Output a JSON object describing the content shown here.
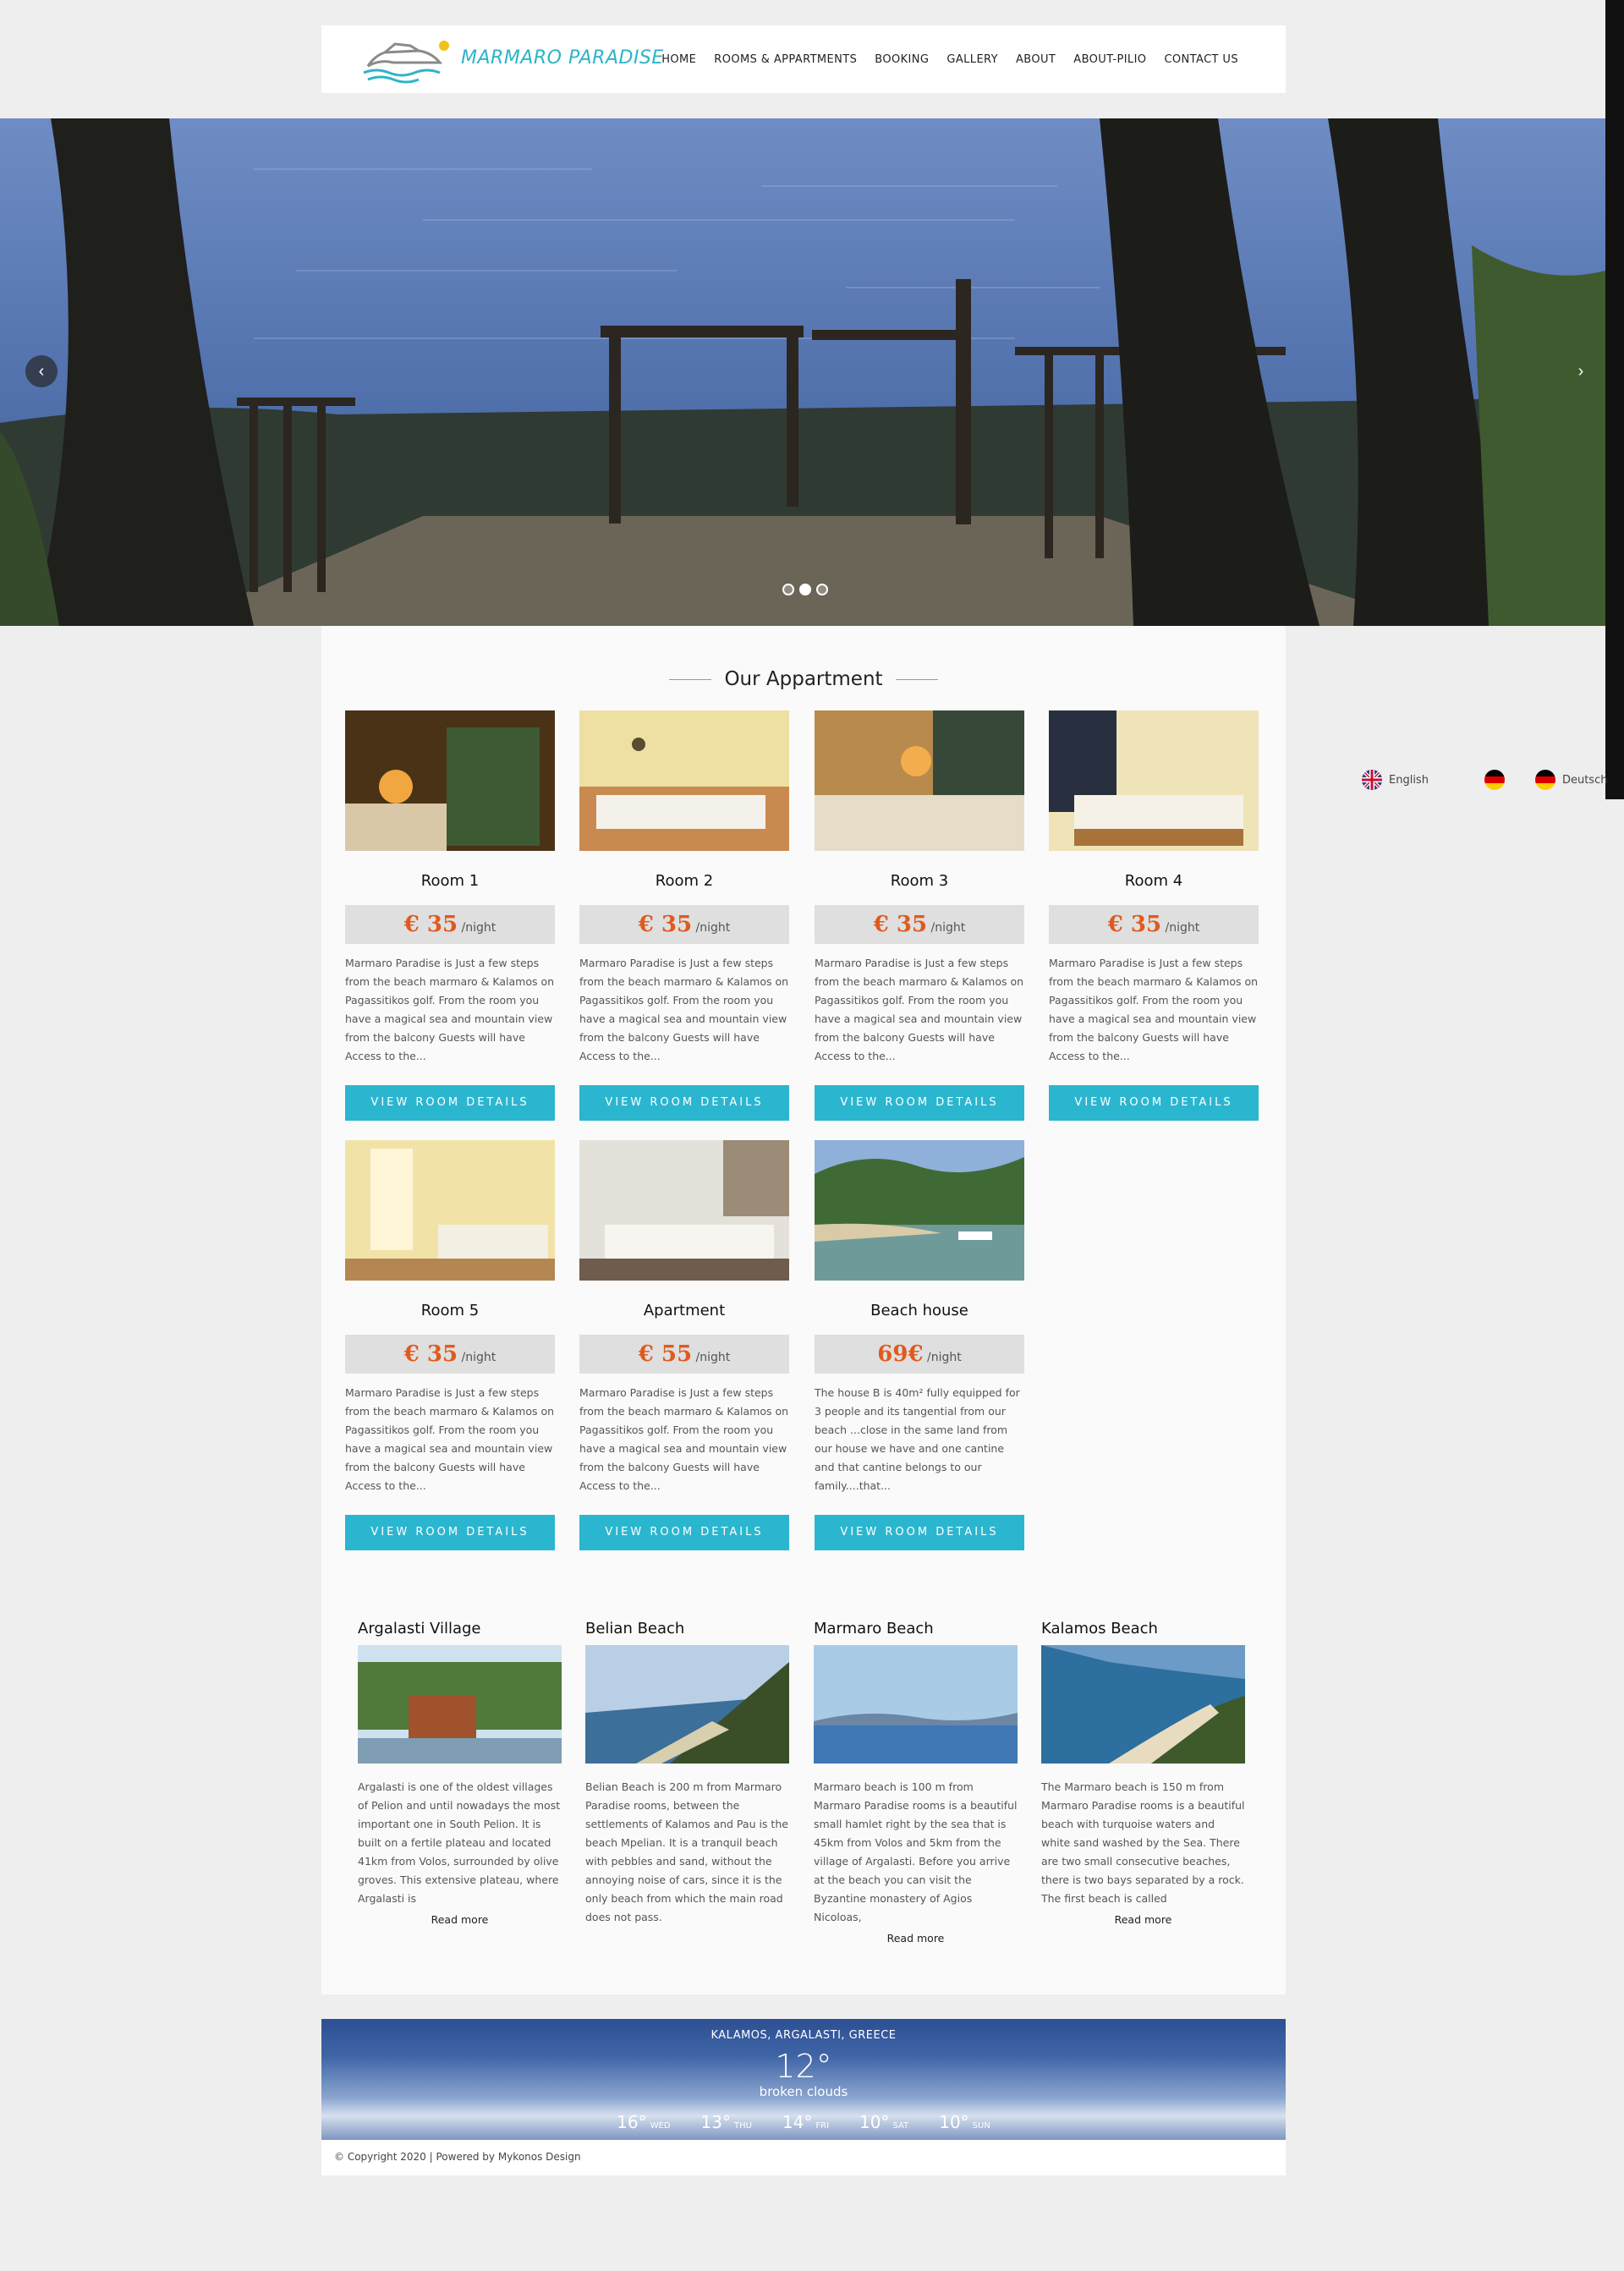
{
  "header": {
    "logo_text": "MARMARO PARADISE",
    "nav": [
      "HOME",
      "ROOMS & APPARTMENTS",
      "BOOKING",
      "GALLERY",
      "ABOUT",
      "ABOUT-PILIO",
      "CONTACT US"
    ]
  },
  "hero": {
    "prev_icon": "‹",
    "next_icon": "›",
    "slide_count": 3,
    "active_slide": 2
  },
  "section_title": "Our Appartment",
  "rooms": [
    {
      "name": "Room 1",
      "price": "€ 35",
      "unit": "/night",
      "desc": "Marmaro Paradise is Just a few steps from the beach marmaro & Kalamos on Pagassitikos golf. From the room you have a magical sea and mountain view from the balcony Guests will have Access to the...",
      "button": "VIEW ROOM DETAILS"
    },
    {
      "name": "Room 2",
      "price": "€ 35",
      "unit": "/night",
      "desc": "Marmaro Paradise is Just a few steps from the beach marmaro & Kalamos on Pagassitikos golf. From the room you have a magical sea and mountain view from the balcony Guests will have Access to the...",
      "button": "VIEW ROOM DETAILS"
    },
    {
      "name": "Room 3",
      "price": "€ 35",
      "unit": "/night",
      "desc": "Marmaro Paradise is Just a few steps from the beach marmaro & Kalamos on Pagassitikos golf. From the room you have a magical sea and mountain view from the balcony Guests will have Access to the...",
      "button": "VIEW ROOM DETAILS"
    },
    {
      "name": "Room 4",
      "price": "€ 35",
      "unit": "/night",
      "desc": "Marmaro Paradise is Just a few steps from the beach marmaro & Kalamos on Pagassitikos golf. From the room you have a magical sea and mountain view from the balcony Guests will have Access to the...",
      "button": "VIEW ROOM DETAILS"
    },
    {
      "name": "Room 5",
      "price": "€ 35",
      "unit": "/night",
      "desc": "Marmaro Paradise is Just a few steps from the beach marmaro & Kalamos on Pagassitikos golf. From the room you have a magical sea and mountain view from the balcony Guests will have Access to the...",
      "button": "VIEW ROOM DETAILS"
    },
    {
      "name": "Apartment",
      "price": "€ 55",
      "unit": "/night",
      "desc": "Marmaro Paradise is Just a few steps from the beach marmaro & Kalamos on Pagassitikos golf. From the room you have a magical sea and mountain view from the balcony Guests will have Access to the...",
      "button": "VIEW ROOM DETAILS"
    },
    {
      "name": "Beach house",
      "price": "69€",
      "unit": "/night",
      "desc": "The house B is 40m² fully equipped for 3 people and its tangential from our beach ...close in the same land from our house we have and one cantine and that cantine belongs to our family....that...",
      "button": "VIEW ROOM DETAILS"
    }
  ],
  "places": [
    {
      "title": "Argalasti Village",
      "desc": "Argalasti is one of the oldest villages of Pelion and until nowadays the most important one in South Pelion. It is built on a fertile plateau and located 41km from Volos, surrounded by olive groves. This extensive plateau, where Argalasti is",
      "more": "Read more"
    },
    {
      "title": "Belian Beach",
      "desc": "Belian Beach is 200 m from Marmaro Paradise rooms, between the settlements of Kalamos and Pau is the beach Mpelian. It is a tranquil beach with pebbles and sand, without the annoying noise of cars, since it is the only beach from which the main road does not pass.",
      "more": ""
    },
    {
      "title": "Marmaro Beach",
      "desc": "Marmaro beach is 100 m from Marmaro Paradise rooms is a beautiful small hamlet right by the sea that is 45km from Volos and 5km from the village of Argalasti. Before you arrive at the beach you can visit the Byzantine monastery of Agios Nicoloas,",
      "more": "Read more"
    },
    {
      "title": "Kalamos Beach",
      "desc": "The Marmaro beach is 150 m from Marmaro Paradise rooms is a beautiful beach with turquoise waters and white sand washed by the Sea. There are two small consecutive beaches, there is two bays separated by a rock. The first beach is called",
      "more": "Read more"
    }
  ],
  "languages": [
    "English",
    "",
    "Deutsch"
  ],
  "weather": {
    "location": "KALAMOS, ARGALASTI, GREECE",
    "temp": "12°",
    "condition": "broken clouds",
    "forecast": [
      {
        "temp": "16°",
        "day": "WED"
      },
      {
        "temp": "13°",
        "day": "THU"
      },
      {
        "temp": "14°",
        "day": "FRI"
      },
      {
        "temp": "10°",
        "day": "SAT"
      },
      {
        "temp": "10°",
        "day": "SUN"
      }
    ]
  },
  "footer": "© Copyright 2020 | Powered by Mykonos Design",
  "colors": {
    "accent": "#2bb6cf",
    "price": "#e05a1e",
    "logo": "#2db4c8"
  }
}
